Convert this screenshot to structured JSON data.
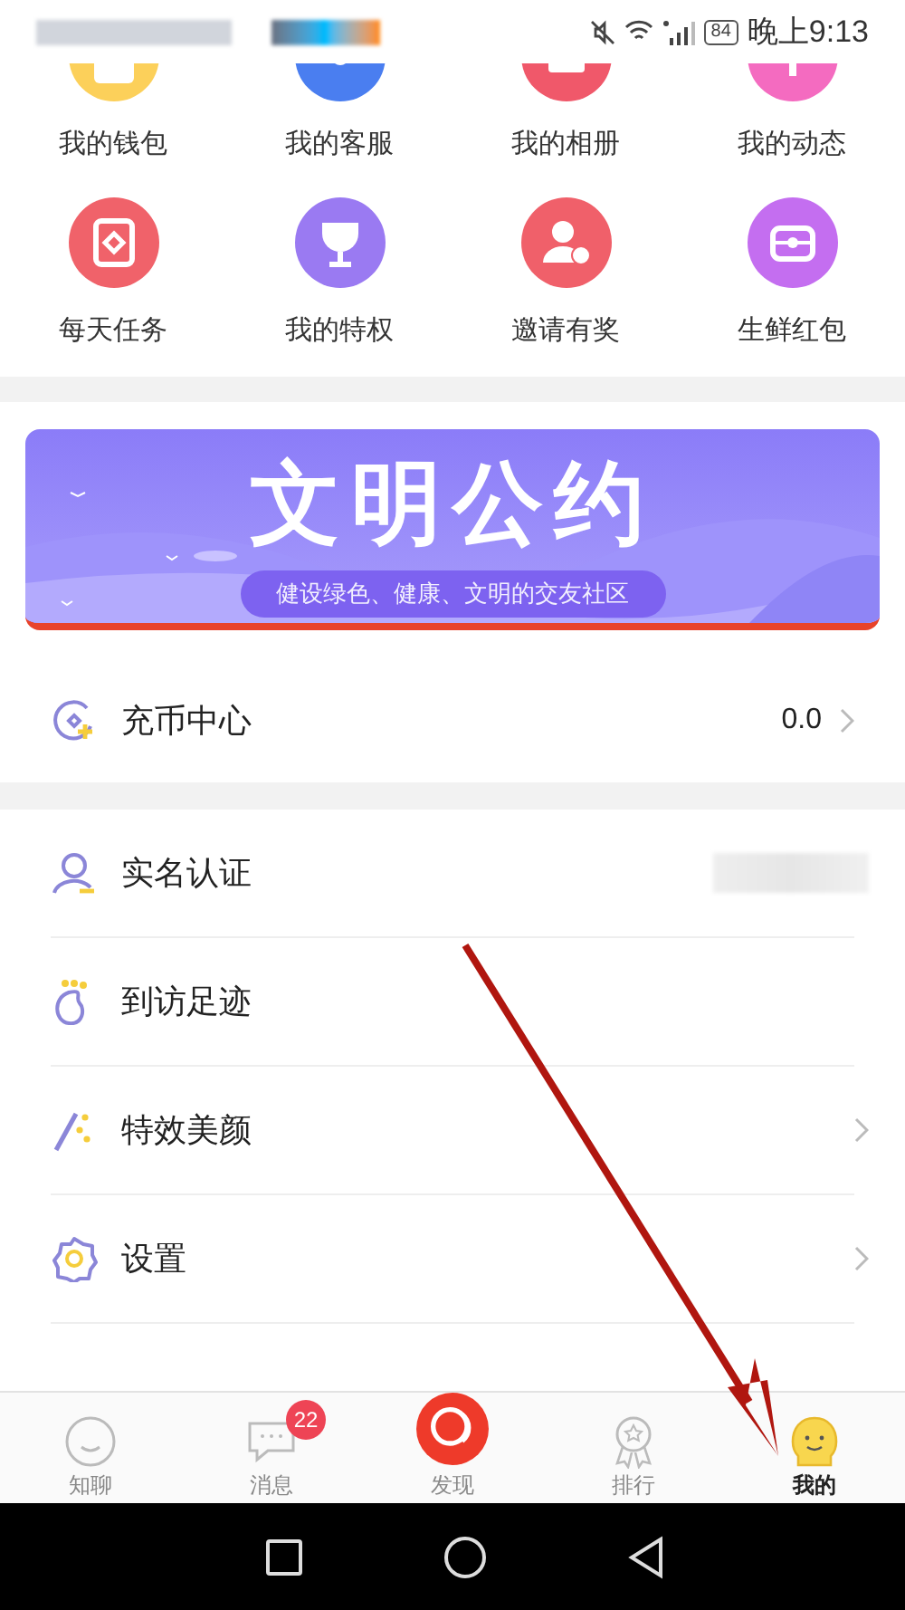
{
  "status_bar": {
    "battery": "84",
    "time": "晚上9:13"
  },
  "shortcuts": [
    {
      "label": "我的钱包",
      "color": "#fcd05a"
    },
    {
      "label": "我的客服",
      "color": "#4a7ef0"
    },
    {
      "label": "我的相册",
      "color": "#f0586a"
    },
    {
      "label": "我的动态",
      "color": "#f46bc0"
    },
    {
      "label": "每天任务",
      "color": "#f0626a"
    },
    {
      "label": "我的特权",
      "color": "#9a7af2"
    },
    {
      "label": "邀请有奖",
      "color": "#f0606a"
    },
    {
      "label": "生鲜红包",
      "color": "#c46ef0"
    }
  ],
  "banner": {
    "title": "文明公约",
    "subtitle": "健设绿色、健康、文明的交友社区"
  },
  "recharge": {
    "label": "充币中心",
    "value": "0.0"
  },
  "menu": [
    {
      "label": "实名认证",
      "kind": "verify",
      "chevron": false,
      "blurred_value": true
    },
    {
      "label": "到访足迹",
      "kind": "footprint",
      "chevron": false,
      "blurred_value": false
    },
    {
      "label": "特效美颜",
      "kind": "beauty",
      "chevron": true,
      "blurred_value": false
    },
    {
      "label": "设置",
      "kind": "settings",
      "chevron": true,
      "blurred_value": false
    }
  ],
  "tabs": [
    {
      "label": "知聊",
      "kind": "chat",
      "selected": false
    },
    {
      "label": "消息",
      "kind": "message",
      "selected": false,
      "badge": "22"
    },
    {
      "label": "发现",
      "kind": "discover",
      "selected": false
    },
    {
      "label": "排行",
      "kind": "rank",
      "selected": false
    },
    {
      "label": "我的",
      "kind": "me",
      "selected": true
    }
  ]
}
